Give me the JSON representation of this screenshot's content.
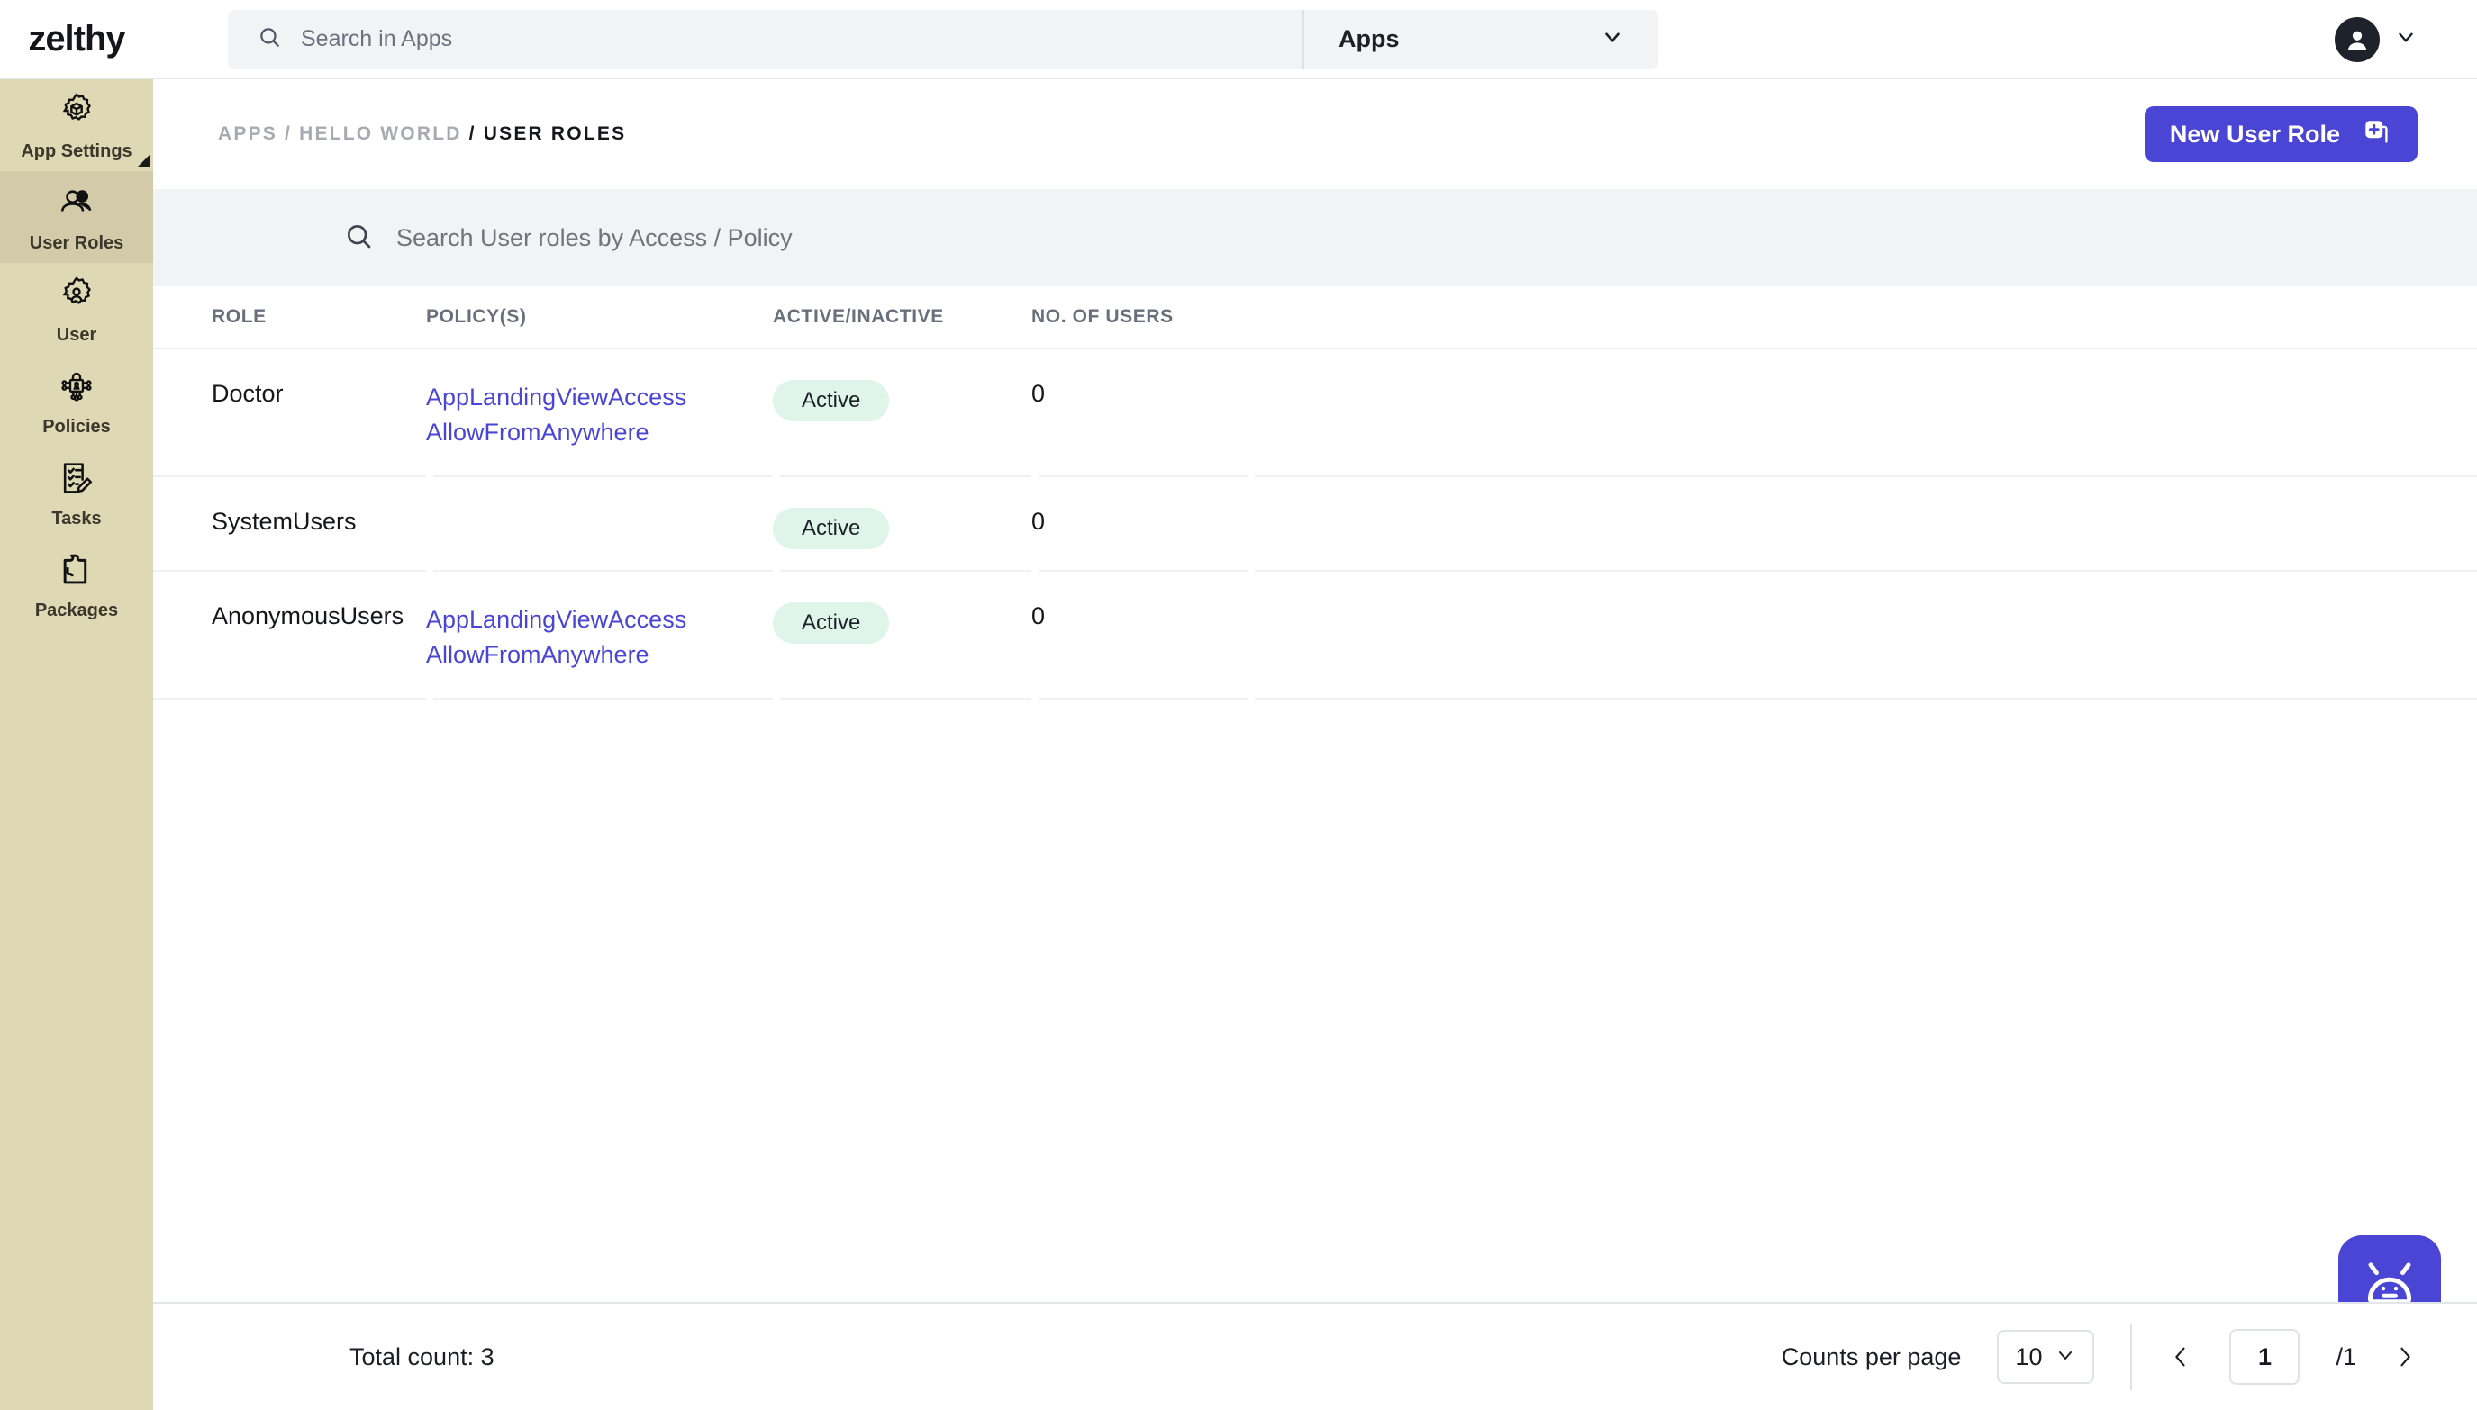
{
  "brand": {
    "logo": "zelthy",
    "accent": "#4b45d6",
    "sidebar_bg": "#dfd8b4",
    "sidebar_active_bg": "#d2caa8",
    "badge_bg": "#dff5ea"
  },
  "topbar": {
    "search_placeholder": "Search in Apps",
    "search_value": "",
    "scope_label": "Apps",
    "search_icon": "search-icon",
    "scope_chevron_icon": "chevron-down-icon",
    "avatar_icon": "user-avatar-icon",
    "avatar_chevron_icon": "chevron-down-icon"
  },
  "sidebar": {
    "items": [
      {
        "label": "App Settings",
        "icon": "gear-cube-icon",
        "active": false,
        "corner_marker": true
      },
      {
        "label": "User Roles",
        "icon": "users-icon",
        "active": true,
        "corner_marker": false
      },
      {
        "label": "User",
        "icon": "gear-user-icon",
        "active": false,
        "corner_marker": false
      },
      {
        "label": "Policies",
        "icon": "lock-network-icon",
        "active": false,
        "corner_marker": false
      },
      {
        "label": "Tasks",
        "icon": "checklist-pencil-icon",
        "active": false,
        "corner_marker": false
      },
      {
        "label": "Packages",
        "icon": "puzzle-piece-icon",
        "active": false,
        "corner_marker": false
      }
    ]
  },
  "breadcrumb": {
    "trail": "APPS / HELLO WORLD",
    "separator": "/",
    "current": "USER ROLES"
  },
  "actions": {
    "new_user_role_label": "New User Role",
    "new_user_role_icon": "plus-square-icon"
  },
  "table_search": {
    "placeholder": "Search User roles by Access / Policy",
    "value": "",
    "icon": "search-icon"
  },
  "table": {
    "columns": [
      "ROLE",
      "POLICY(S)",
      "ACTIVE/INACTIVE",
      "NO. OF USERS"
    ],
    "rows": [
      {
        "role": "Doctor",
        "policies": [
          "AppLandingViewAccess",
          "AllowFromAnywhere"
        ],
        "status": "Active",
        "users": "0"
      },
      {
        "role": "SystemUsers",
        "policies": [],
        "status": "Active",
        "users": "0"
      },
      {
        "role": "AnonymousUsers",
        "policies": [
          "AppLandingViewAccess",
          "AllowFromAnywhere"
        ],
        "status": "Active",
        "users": "0"
      }
    ]
  },
  "footer": {
    "total_count": "Total count: 3",
    "counts_per_page_label": "Counts per page",
    "counts_per_page_value": "10",
    "counts_chevron_icon": "chevron-down-icon",
    "prev_icon": "chevron-left-icon",
    "next_icon": "chevron-right-icon",
    "current_page": "1",
    "total_pages": "/1"
  },
  "chat_widget": {
    "icon": "robot-bot-icon"
  }
}
